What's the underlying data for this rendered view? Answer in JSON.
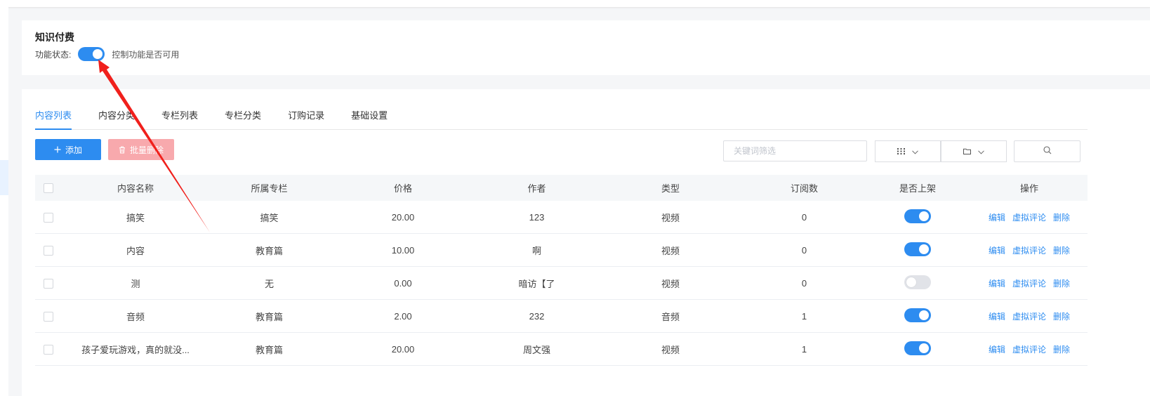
{
  "colors": {
    "primary": "#2d8cf0",
    "danger_disabled": "#f8a9ad",
    "annotation_arrow": "#f0201c",
    "toggle_off": "#e1e3e8"
  },
  "feature": {
    "title": "知识付费",
    "status_label": "功能状态:",
    "status_on": true,
    "status_desc": "控制功能是否可用"
  },
  "tabs": [
    {
      "label": "内容列表",
      "active": true
    },
    {
      "label": "内容分类",
      "active": false
    },
    {
      "label": "专栏列表",
      "active": false
    },
    {
      "label": "专栏分类",
      "active": false
    },
    {
      "label": "订购记录",
      "active": false
    },
    {
      "label": "基础设置",
      "active": false
    }
  ],
  "toolbar": {
    "add_label": "添加",
    "batch_delete_label": "批量删除",
    "search_placeholder": "关键词筛选",
    "grid_icon": "grid-icon",
    "folder_icon": "folder-icon",
    "search_icon": "search-icon"
  },
  "table": {
    "headers": [
      "内容名称",
      "所属专栏",
      "价格",
      "作者",
      "类型",
      "订阅数",
      "是否上架",
      "操作"
    ],
    "rows": [
      {
        "name": "搞笑",
        "column": "搞笑",
        "price": "20.00",
        "author": "123",
        "type": "视频",
        "subs": "0",
        "listed": true
      },
      {
        "name": "内容",
        "column": "教育篇",
        "price": "10.00",
        "author": "啊",
        "type": "视频",
        "subs": "0",
        "listed": true
      },
      {
        "name": "测",
        "column": "无",
        "price": "0.00",
        "author": "暗访【了",
        "type": "视频",
        "subs": "0",
        "listed": false
      },
      {
        "name": "音频",
        "column": "教育篇",
        "price": "2.00",
        "author": "232",
        "type": "音频",
        "subs": "1",
        "listed": true
      },
      {
        "name": "孩子爱玩游戏，真的就没...",
        "column": "教育篇",
        "price": "20.00",
        "author": "周文强",
        "type": "视频",
        "subs": "1",
        "listed": true
      }
    ],
    "actions": {
      "edit": "编辑",
      "virtual_comment": "虚拟评论",
      "delete": "删除"
    }
  }
}
